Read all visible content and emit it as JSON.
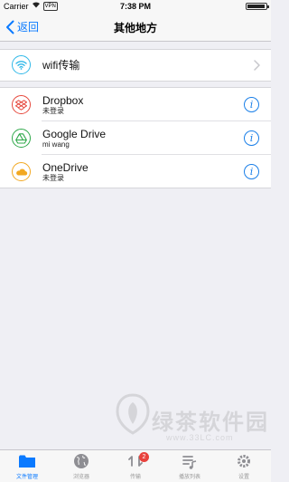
{
  "status_bar": {
    "carrier": "Carrier",
    "vpn": "VPN",
    "time": "7:38 PM"
  },
  "nav": {
    "back_label": "返回",
    "title": "其他地方"
  },
  "wifi_row": {
    "title": "wifi传输",
    "icon": "wifi-icon",
    "color": "#2fb8e8"
  },
  "cloud_services": [
    {
      "title": "Dropbox",
      "subtitle": "未登录",
      "icon": "dropbox-icon",
      "color": "#e6483c"
    },
    {
      "title": "Google Drive",
      "subtitle": "mi wang",
      "icon": "google-drive-icon",
      "color": "#2fa84a"
    },
    {
      "title": "OneDrive",
      "subtitle": "未登录",
      "icon": "onedrive-icon",
      "color": "#f2a821"
    }
  ],
  "info_glyph": "i",
  "watermark": {
    "text": "绿茶软件园",
    "url": "www.33LC.com"
  },
  "tabs": [
    {
      "label": "文件管理",
      "icon": "folder-icon",
      "active": true
    },
    {
      "label": "浏览器",
      "icon": "globe-icon",
      "active": false
    },
    {
      "label": "传输",
      "icon": "transfer-icon",
      "active": false,
      "badge": "2"
    },
    {
      "label": "播放列表",
      "icon": "playlist-icon",
      "active": false
    },
    {
      "label": "设置",
      "icon": "settings-icon",
      "active": false
    }
  ],
  "colors": {
    "accent": "#0a7aff",
    "info": "#1a7fe8",
    "badge": "#e8413c"
  }
}
